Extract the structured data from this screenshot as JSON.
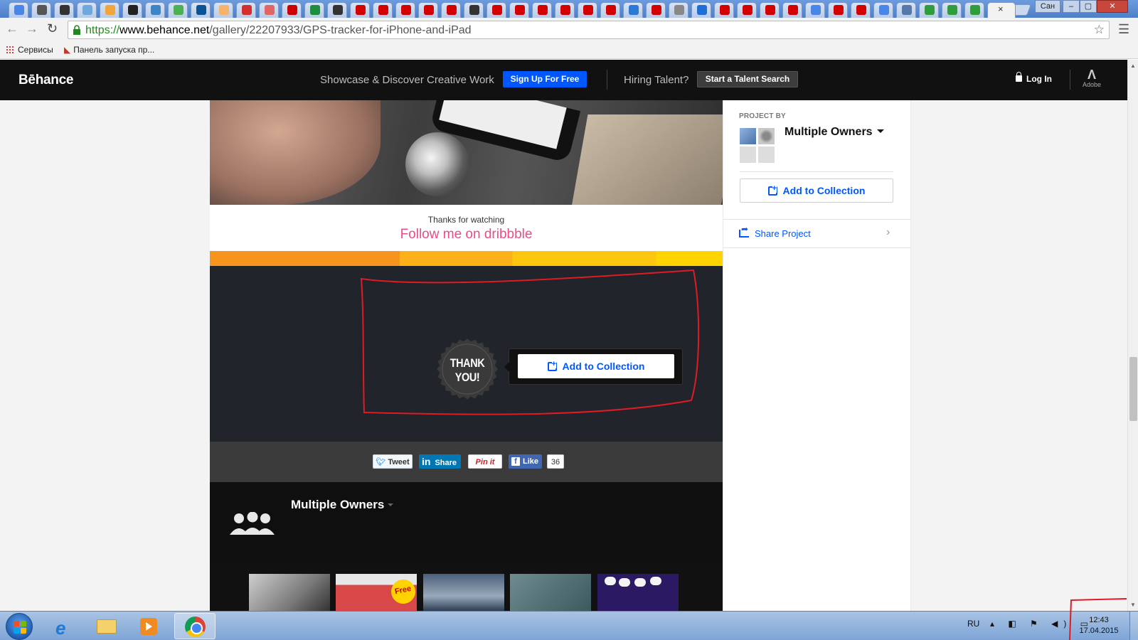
{
  "browser": {
    "tab_close": "×",
    "window_user": "Сан",
    "window_controls": [
      "–",
      "▢",
      "✕"
    ],
    "url_scheme": "https://",
    "url_host": "www.behance.net",
    "url_path": "/gallery/22207933/GPS-tracker-for-iPhone-and-iPad",
    "bookmarks": [
      "Сервисы",
      "Панель запуска пр..."
    ],
    "favicon_colors": [
      "#4a86e8",
      "#555555",
      "#333333",
      "#6fa8dc",
      "#f1a33c",
      "#222222",
      "#3d85c6",
      "#4caf50",
      "#0b5394",
      "#f6b26b",
      "#d32f2f",
      "#e06666",
      "#cc0000",
      "#1e8e3e",
      "#333333",
      "#d40000",
      "#d40000",
      "#d40000",
      "#d40000",
      "#d40000",
      "#333333",
      "#d40000",
      "#d40000",
      "#d40000",
      "#d40000",
      "#d40000",
      "#d40000",
      "#2a7ad6",
      "#d40000",
      "#888888",
      "#1e6ed6",
      "#d40000",
      "#d40000",
      "#d40000",
      "#d40000",
      "#4a86e8",
      "#d40000",
      "#d40000",
      "#4a86e8",
      "#5577aa",
      "#2e9d3a",
      "#2e9d3a",
      "#2e9d3a"
    ]
  },
  "header": {
    "logo": "Bēhance",
    "tagline": "Showcase & Discover Creative Work",
    "signup_label": "Sign Up For Free",
    "hiring_label": "Hiring Talent?",
    "talent_button": "Start a Talent Search",
    "login_label": "Log In",
    "adobe_label": "Adobe"
  },
  "project": {
    "thanks_small": "Thanks for watching",
    "thanks_big": "Follow me on dribbble",
    "badge_line1": "THANK",
    "badge_line2": "YOU!",
    "add_to_collection": "Add to Collection",
    "share_buttons": {
      "tweet": "Tweet",
      "linkedin": "Share",
      "pinterest": "Pin it",
      "facebook": "Like",
      "facebook_count": "36"
    },
    "owners_name": "Multiple Owners",
    "thumb_free_label": "Free"
  },
  "sidebar": {
    "project_by": "PROJECT BY",
    "owner_name": "Multiple Owners",
    "add_to_collection": "Add to Collection",
    "share_project": "Share Project"
  },
  "taskbar": {
    "language": "RU",
    "time": "12:43",
    "date": "17.04.2015"
  },
  "colors": {
    "behance_blue": "#0057ff",
    "dribbble_pink": "#ea4c89",
    "annotation_red": "#e01b24"
  }
}
